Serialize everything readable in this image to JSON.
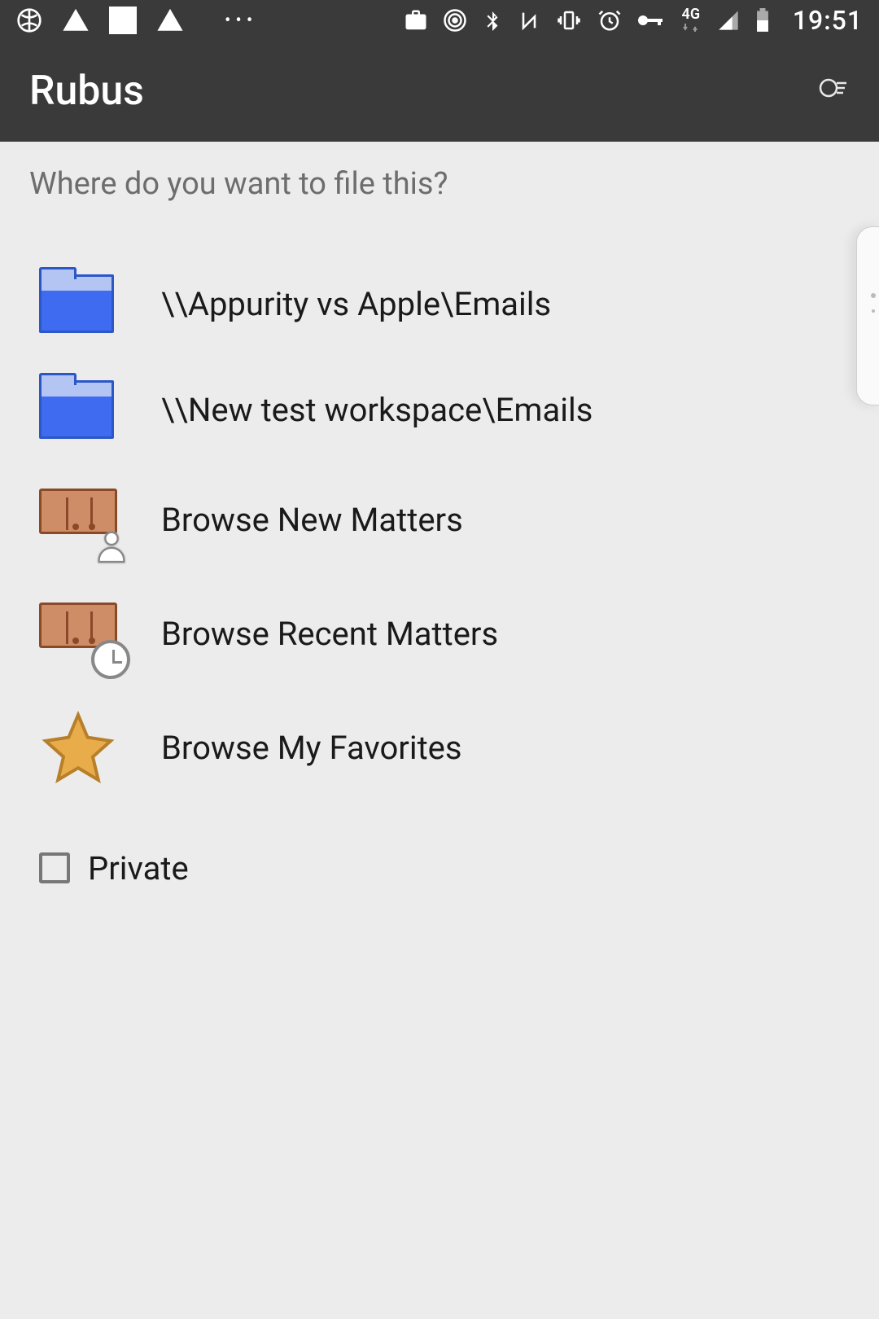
{
  "status": {
    "network": "4G",
    "clock": "19:51"
  },
  "app": {
    "title": "Rubus"
  },
  "prompt": "Where do you want to file this?",
  "options": [
    {
      "label": "\\\\Appurity vs Apple\\Emails"
    },
    {
      "label": "\\\\New test workspace\\Emails"
    },
    {
      "label": "Browse New Matters"
    },
    {
      "label": "Browse Recent Matters"
    },
    {
      "label": "Browse My Favorites"
    }
  ],
  "private": {
    "label": "Private",
    "checked": false
  }
}
